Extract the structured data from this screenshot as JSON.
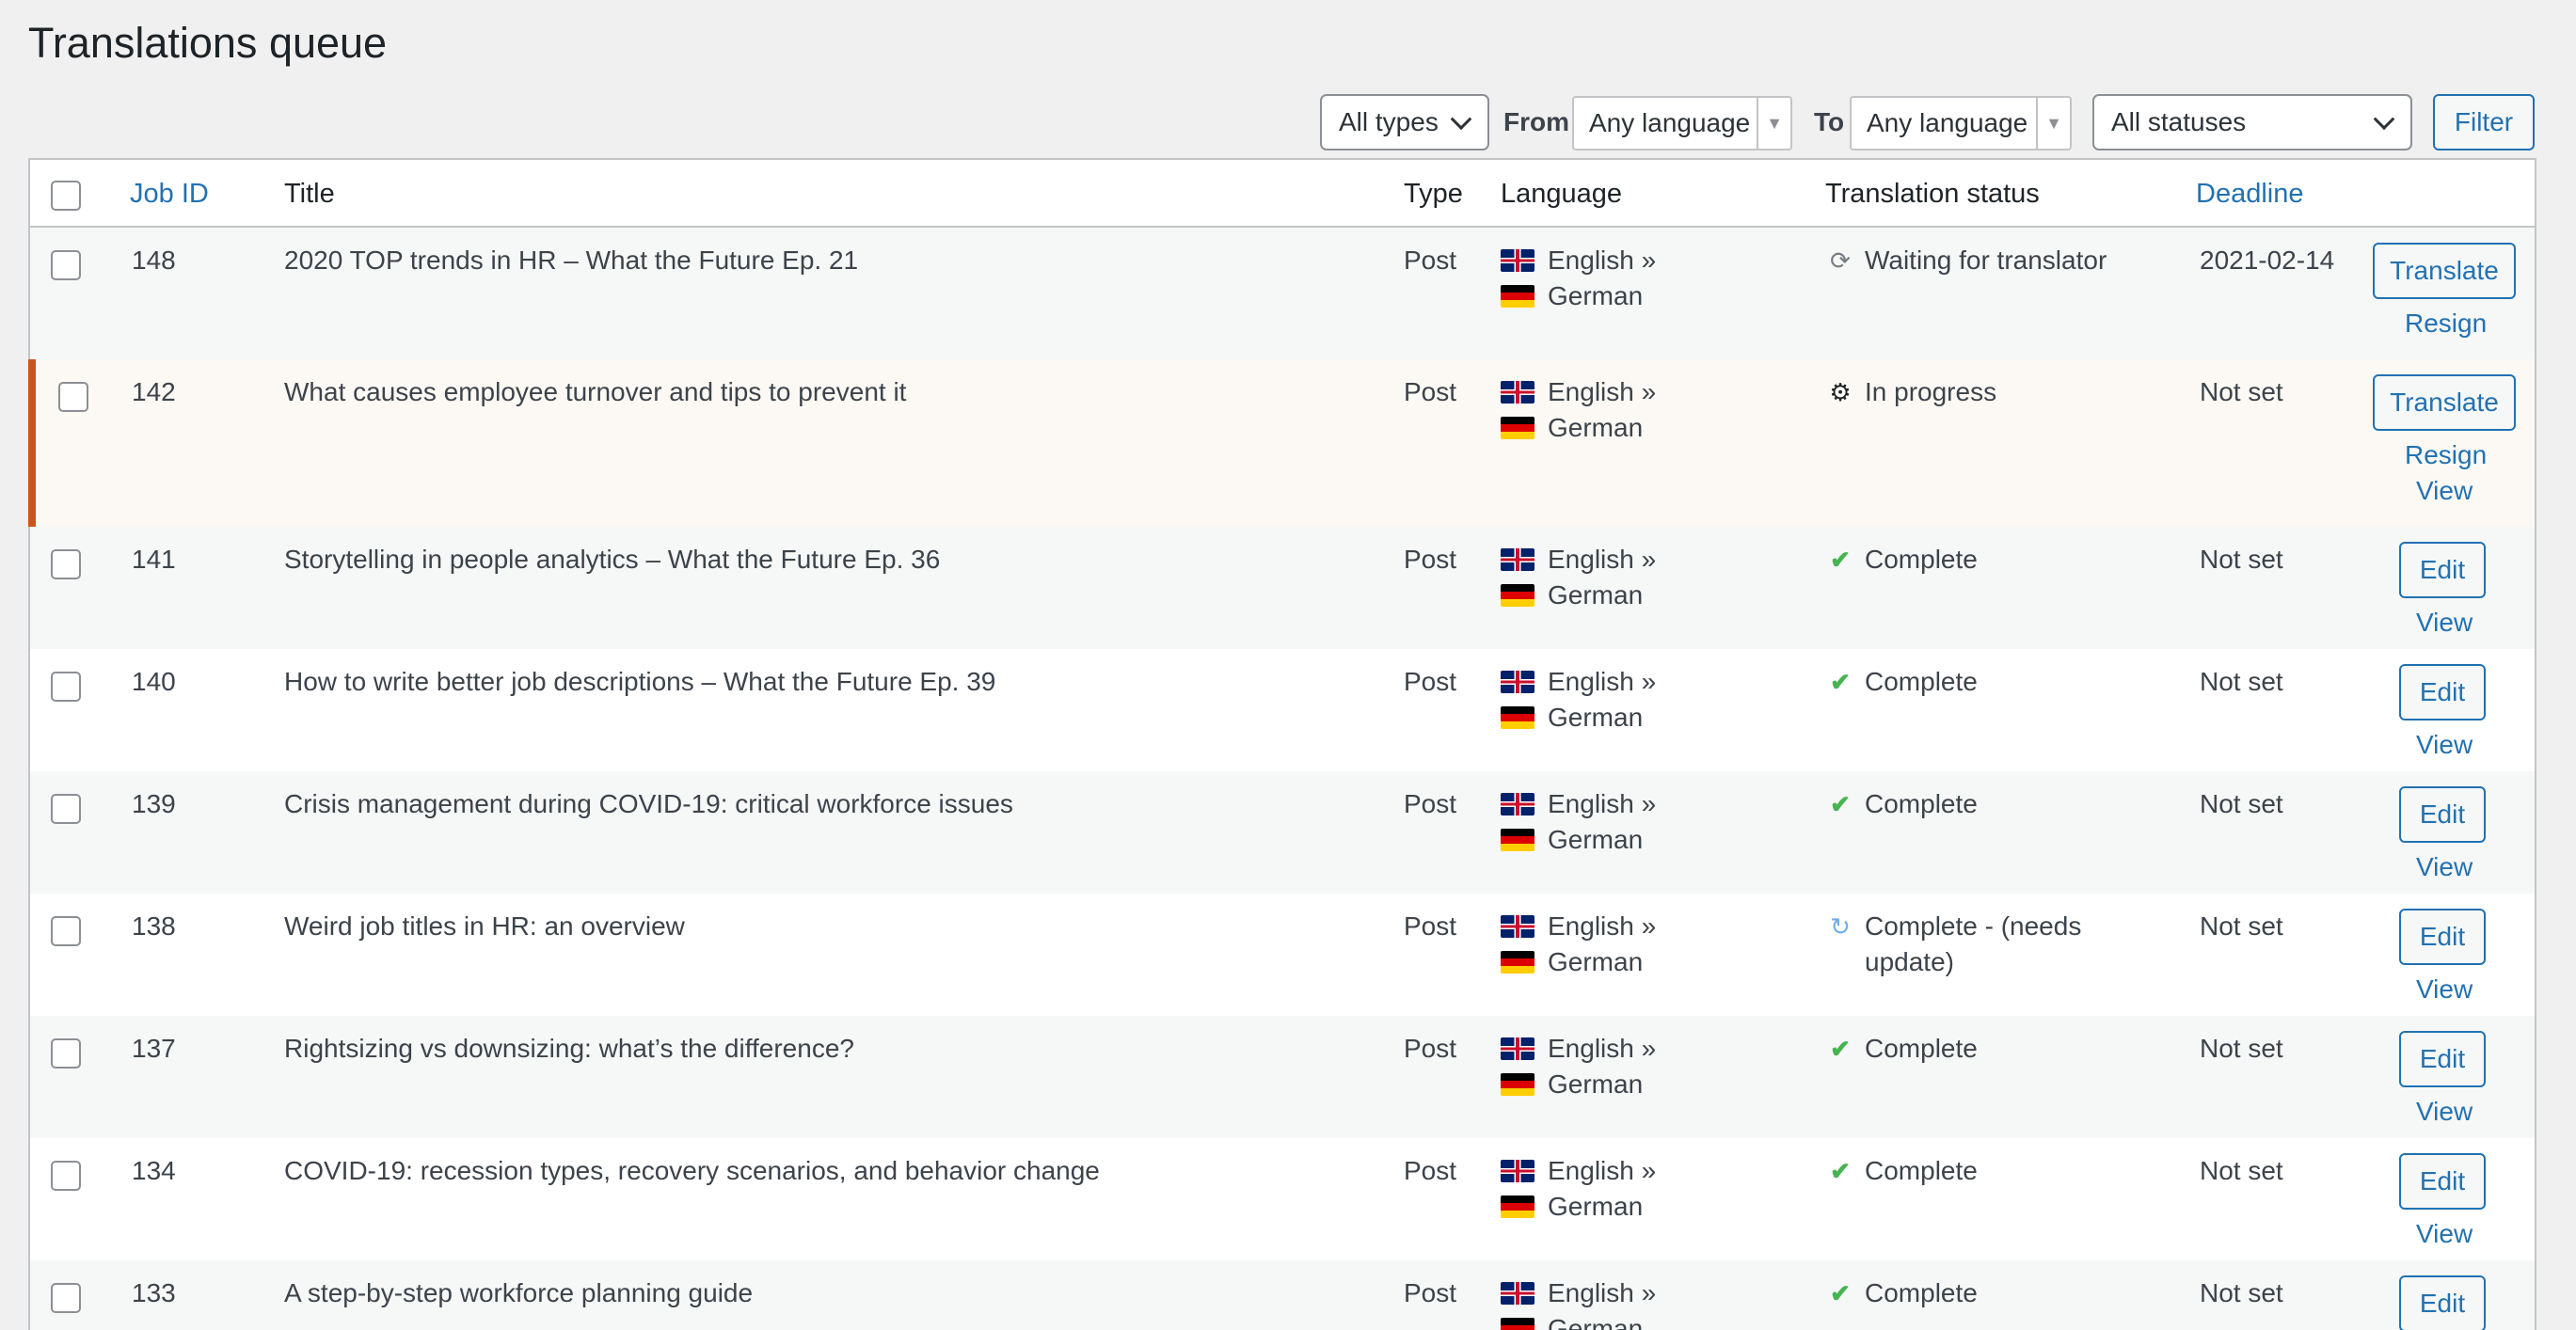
{
  "page": {
    "title": "Translations queue"
  },
  "filters": {
    "type": "All types",
    "from_label": "From",
    "from_value": "Any language",
    "to_label": "To",
    "to_value": "Any language",
    "status": "All statuses",
    "filter_button": "Filter"
  },
  "table": {
    "headers": {
      "job_id": "Job ID",
      "title": "Title",
      "type": "Type",
      "language": "Language",
      "status": "Translation status",
      "deadline": "Deadline"
    },
    "rows": [
      {
        "id": "148",
        "title": "2020 TOP trends in HR – What the Future Ep. 21",
        "type": "Post",
        "lang_from": "English »",
        "lang_to": "German",
        "status_icon": "waiting-icon",
        "status_line1": "Waiting for translator",
        "status_line2": "",
        "deadline": "2021-02-14",
        "button": "Translate",
        "link1": "Resign",
        "link2": ""
      },
      {
        "id": "142",
        "title": "What causes employee turnover and tips to prevent it",
        "type": "Post",
        "lang_from": "English »",
        "lang_to": "German",
        "status_icon": "gears-icon",
        "status_line1": "In progress",
        "status_line2": "",
        "deadline": "Not set",
        "button": "Translate",
        "link1": "Resign",
        "link2": "View"
      },
      {
        "id": "141",
        "title": "Storytelling in people analytics – What the Future Ep. 36",
        "type": "Post",
        "lang_from": "English »",
        "lang_to": "German",
        "status_icon": "check-icon",
        "status_line1": "Complete",
        "status_line2": "",
        "deadline": "Not set",
        "button": "Edit",
        "link1": "View",
        "link2": ""
      },
      {
        "id": "140",
        "title": "How to write better job descriptions – What the Future Ep. 39",
        "type": "Post",
        "lang_from": "English »",
        "lang_to": "German",
        "status_icon": "check-icon",
        "status_line1": "Complete",
        "status_line2": "",
        "deadline": "Not set",
        "button": "Edit",
        "link1": "View",
        "link2": ""
      },
      {
        "id": "139",
        "title": "Crisis management during COVID-19: critical workforce issues",
        "type": "Post",
        "lang_from": "English »",
        "lang_to": "German",
        "status_icon": "check-icon",
        "status_line1": "Complete",
        "status_line2": "",
        "deadline": "Not set",
        "button": "Edit",
        "link1": "View",
        "link2": ""
      },
      {
        "id": "138",
        "title": "Weird job titles in HR: an overview",
        "type": "Post",
        "lang_from": "English »",
        "lang_to": "German",
        "status_icon": "update-icon",
        "status_line1": "Complete - (needs",
        "status_line2": "update)",
        "deadline": "Not set",
        "button": "Edit",
        "link1": "View",
        "link2": ""
      },
      {
        "id": "137",
        "title": "Rightsizing vs downsizing: what’s the difference?",
        "type": "Post",
        "lang_from": "English »",
        "lang_to": "German",
        "status_icon": "check-icon",
        "status_line1": "Complete",
        "status_line2": "",
        "deadline": "Not set",
        "button": "Edit",
        "link1": "View",
        "link2": ""
      },
      {
        "id": "134",
        "title": "COVID-19: recession types, recovery scenarios, and behavior change",
        "type": "Post",
        "lang_from": "English »",
        "lang_to": "German",
        "status_icon": "check-icon",
        "status_line1": "Complete",
        "status_line2": "",
        "deadline": "Not set",
        "button": "Edit",
        "link1": "View",
        "link2": ""
      },
      {
        "id": "133",
        "title": "A step-by-step workforce planning guide",
        "type": "Post",
        "lang_from": "English »",
        "lang_to": "German",
        "status_icon": "check-icon",
        "status_line1": "Complete",
        "status_line2": "",
        "deadline": "Not set",
        "button": "Edit",
        "link1": "",
        "link2": ""
      }
    ]
  }
}
